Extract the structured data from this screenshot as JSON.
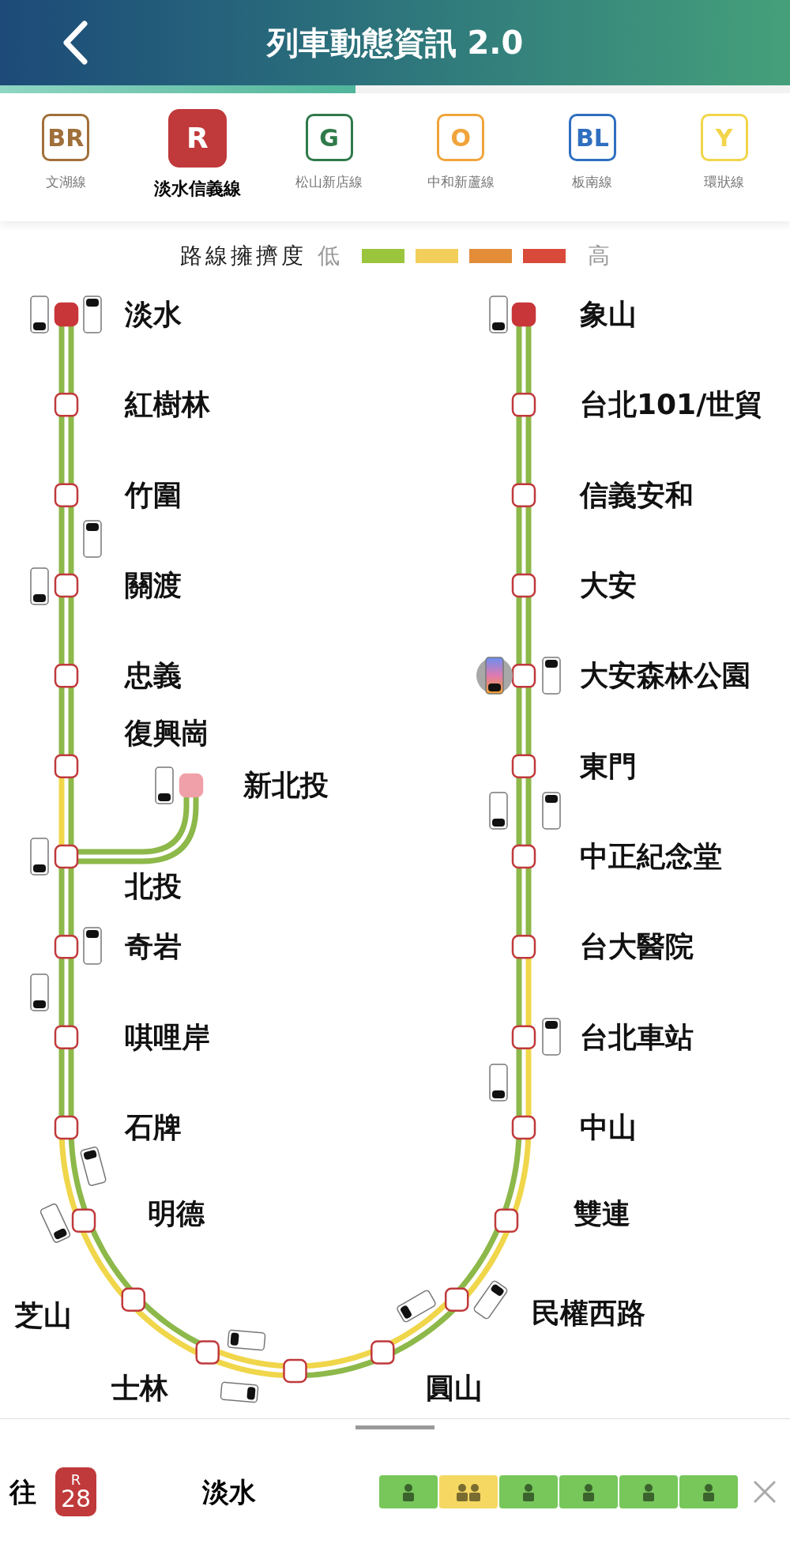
{
  "header": {
    "title": "列車動態資訊 2.0"
  },
  "progress": {
    "level": 0.45
  },
  "lines": [
    {
      "code": "BR",
      "name": "文湖線",
      "color": "#a0703a",
      "selected": false
    },
    {
      "code": "R",
      "name": "淡水信義線",
      "color": "#c0393b",
      "selected": true
    },
    {
      "code": "G",
      "name": "松山新店線",
      "color": "#2f7a4a",
      "selected": false
    },
    {
      "code": "O",
      "name": "中和新蘆線",
      "color": "#f0a43a",
      "selected": false
    },
    {
      "code": "BL",
      "name": "板南線",
      "color": "#2f6fc0",
      "selected": false
    },
    {
      "code": "Y",
      "name": "環狀線",
      "color": "#f2d54a",
      "selected": false
    }
  ],
  "legend": {
    "title": "路線擁擠度",
    "low": "低",
    "high": "高",
    "swatches": [
      {
        "color": "#9bc53d"
      },
      {
        "color": "#f2cf5b"
      },
      {
        "color": "#e38d39"
      },
      {
        "color": "#d94a3a"
      }
    ]
  },
  "left_stations": [
    {
      "name": "淡水",
      "kind": "terminal"
    },
    {
      "name": "紅樹林",
      "kind": "normal"
    },
    {
      "name": "竹圍",
      "kind": "normal"
    },
    {
      "name": "關渡",
      "kind": "normal"
    },
    {
      "name": "忠義",
      "kind": "normal"
    },
    {
      "name": "復興崗",
      "kind": "normal"
    },
    {
      "name": "北投",
      "kind": "normal"
    },
    {
      "name": "奇岩",
      "kind": "normal"
    },
    {
      "name": "唭哩岸",
      "kind": "normal"
    },
    {
      "name": "石牌",
      "kind": "normal"
    },
    {
      "name": "明德",
      "kind": "normal"
    },
    {
      "name": "芝山",
      "kind": "normal"
    },
    {
      "name": "士林",
      "kind": "normal"
    },
    {
      "kind": "normal"
    }
  ],
  "right_stations": [
    {
      "name": "象山",
      "kind": "terminal"
    },
    {
      "name": "台北101/世貿",
      "kind": "normal"
    },
    {
      "name": "信義安和",
      "kind": "normal"
    },
    {
      "name": "大安",
      "kind": "normal"
    },
    {
      "name": "大安森林公園",
      "kind": "normal"
    },
    {
      "name": "東門",
      "kind": "normal"
    },
    {
      "name": "中正紀念堂",
      "kind": "normal"
    },
    {
      "name": "台大醫院",
      "kind": "normal"
    },
    {
      "name": "台北車站",
      "kind": "normal"
    },
    {
      "name": "中山",
      "kind": "normal"
    },
    {
      "name": "雙連",
      "kind": "normal"
    },
    {
      "name": "民權西路",
      "kind": "normal"
    },
    {
      "name": "圓山",
      "kind": "normal"
    }
  ],
  "branch_station": {
    "name": "新北投",
    "kind": "branch_terminal"
  },
  "segments": [
    {
      "outer": {
        "color": "#8db84a"
      },
      "inner": {
        "color": "#8db84a"
      }
    },
    {
      "outer": {
        "color": "#8db84a"
      },
      "inner": {
        "color": "#8db84a"
      }
    },
    {
      "outer": {
        "color": "#8db84a"
      },
      "inner": {
        "color": "#8db84a"
      }
    },
    {
      "outer": {
        "color": "#8db84a"
      },
      "inner": {
        "color": "#8db84a"
      }
    },
    {
      "outer": {
        "color": "#8db84a"
      },
      "inner": {
        "color": "#8db84a"
      }
    },
    {
      "outer": {
        "color": "#f0d64a"
      },
      "inner": {
        "color": "#8db84a"
      }
    },
    {
      "outer": {
        "color": "#8db84a"
      },
      "inner": {
        "color": "#8db84a"
      }
    },
    {
      "outer": {
        "color": "#8db84a"
      },
      "inner": {
        "color": "#8db84a"
      }
    },
    {
      "outer": {
        "color": "#8db84a"
      },
      "inner": {
        "color": "#8db84a"
      }
    },
    {
      "outer": {
        "color": "#f0d64a"
      },
      "inner": {
        "color": "#8db84a"
      }
    },
    {
      "outer": {
        "color": "#f0d64a"
      },
      "inner": {
        "color": "#8db84a"
      }
    },
    {
      "outer": {
        "color": "#f0d64a"
      },
      "inner": {
        "color": "#8db84a"
      }
    },
    {
      "outer": {
        "color": "#f0d64a"
      },
      "inner": {
        "color": "#f0d64a"
      }
    },
    {
      "outer": {
        "color": "#8db84a"
      },
      "inner": {
        "color": "#f0d64a"
      }
    },
    {
      "outer": {
        "color": "#8db84a"
      },
      "inner": {
        "color": "#f0d64a"
      }
    },
    {
      "outer": {
        "color": "#f0d64a"
      },
      "inner": {
        "color": "#8db84a"
      }
    },
    {
      "outer": {
        "color": "#f0d64a"
      },
      "inner": {
        "color": "#8db84a"
      }
    },
    {
      "outer": {
        "color": "#f0d64a"
      },
      "inner": {
        "color": "#8db84a"
      }
    },
    {
      "outer": {
        "color": "#f0d64a"
      },
      "inner": {
        "color": "#8db84a"
      }
    },
    {
      "outer": {
        "color": "#8db84a"
      },
      "inner": {
        "color": "#8db84a"
      }
    },
    {
      "outer": {
        "color": "#8db84a"
      },
      "inner": {
        "color": "#8db84a"
      }
    },
    {
      "outer": {
        "color": "#8db84a"
      },
      "inner": {
        "color": "#8db84a"
      }
    },
    {
      "outer": {
        "color": "#8db84a"
      },
      "inner": {
        "color": "#8db84a"
      }
    },
    {
      "outer": {
        "color": "#8db84a"
      },
      "inner": {
        "color": "#8db84a"
      }
    },
    {
      "outer": {
        "color": "#8db84a"
      },
      "inner": {
        "color": "#8db84a"
      }
    },
    {
      "outer": {
        "color": "#8db84a"
      },
      "inner": {
        "color": "#8db84a"
      }
    }
  ],
  "branch_segment": {
    "outer": {
      "color": "#8db84a"
    },
    "inner": {
      "color": "#8db84a"
    }
  },
  "trains": [
    {
      "selected": false
    },
    {
      "selected": false
    },
    {
      "selected": false
    },
    {
      "selected": false
    },
    {
      "selected": false
    },
    {
      "selected": false
    },
    {
      "selected": false
    },
    {
      "selected": false
    },
    {
      "selected": false
    },
    {
      "selected": false
    },
    {
      "selected": false
    },
    {
      "selected": false
    },
    {
      "selected": false
    },
    {
      "selected": false
    },
    {
      "selected": false
    },
    {
      "selected": false
    },
    {
      "selected": false
    },
    {
      "selected": false
    },
    {
      "selected": true
    },
    {
      "selected": false
    },
    {
      "selected": false
    }
  ],
  "train_info": {
    "direction_label": "往",
    "station_badge": {
      "line": "R",
      "number": "28"
    },
    "destination": "淡水",
    "cars": [
      {
        "color": "#77c75a",
        "kind": "single"
      },
      {
        "color": "#f5d862",
        "kind": "double"
      },
      {
        "color": "#77c75a",
        "kind": "single"
      },
      {
        "color": "#77c75a",
        "kind": "single"
      },
      {
        "color": "#77c75a",
        "kind": "single"
      },
      {
        "color": "#77c75a",
        "kind": "single"
      }
    ]
  }
}
